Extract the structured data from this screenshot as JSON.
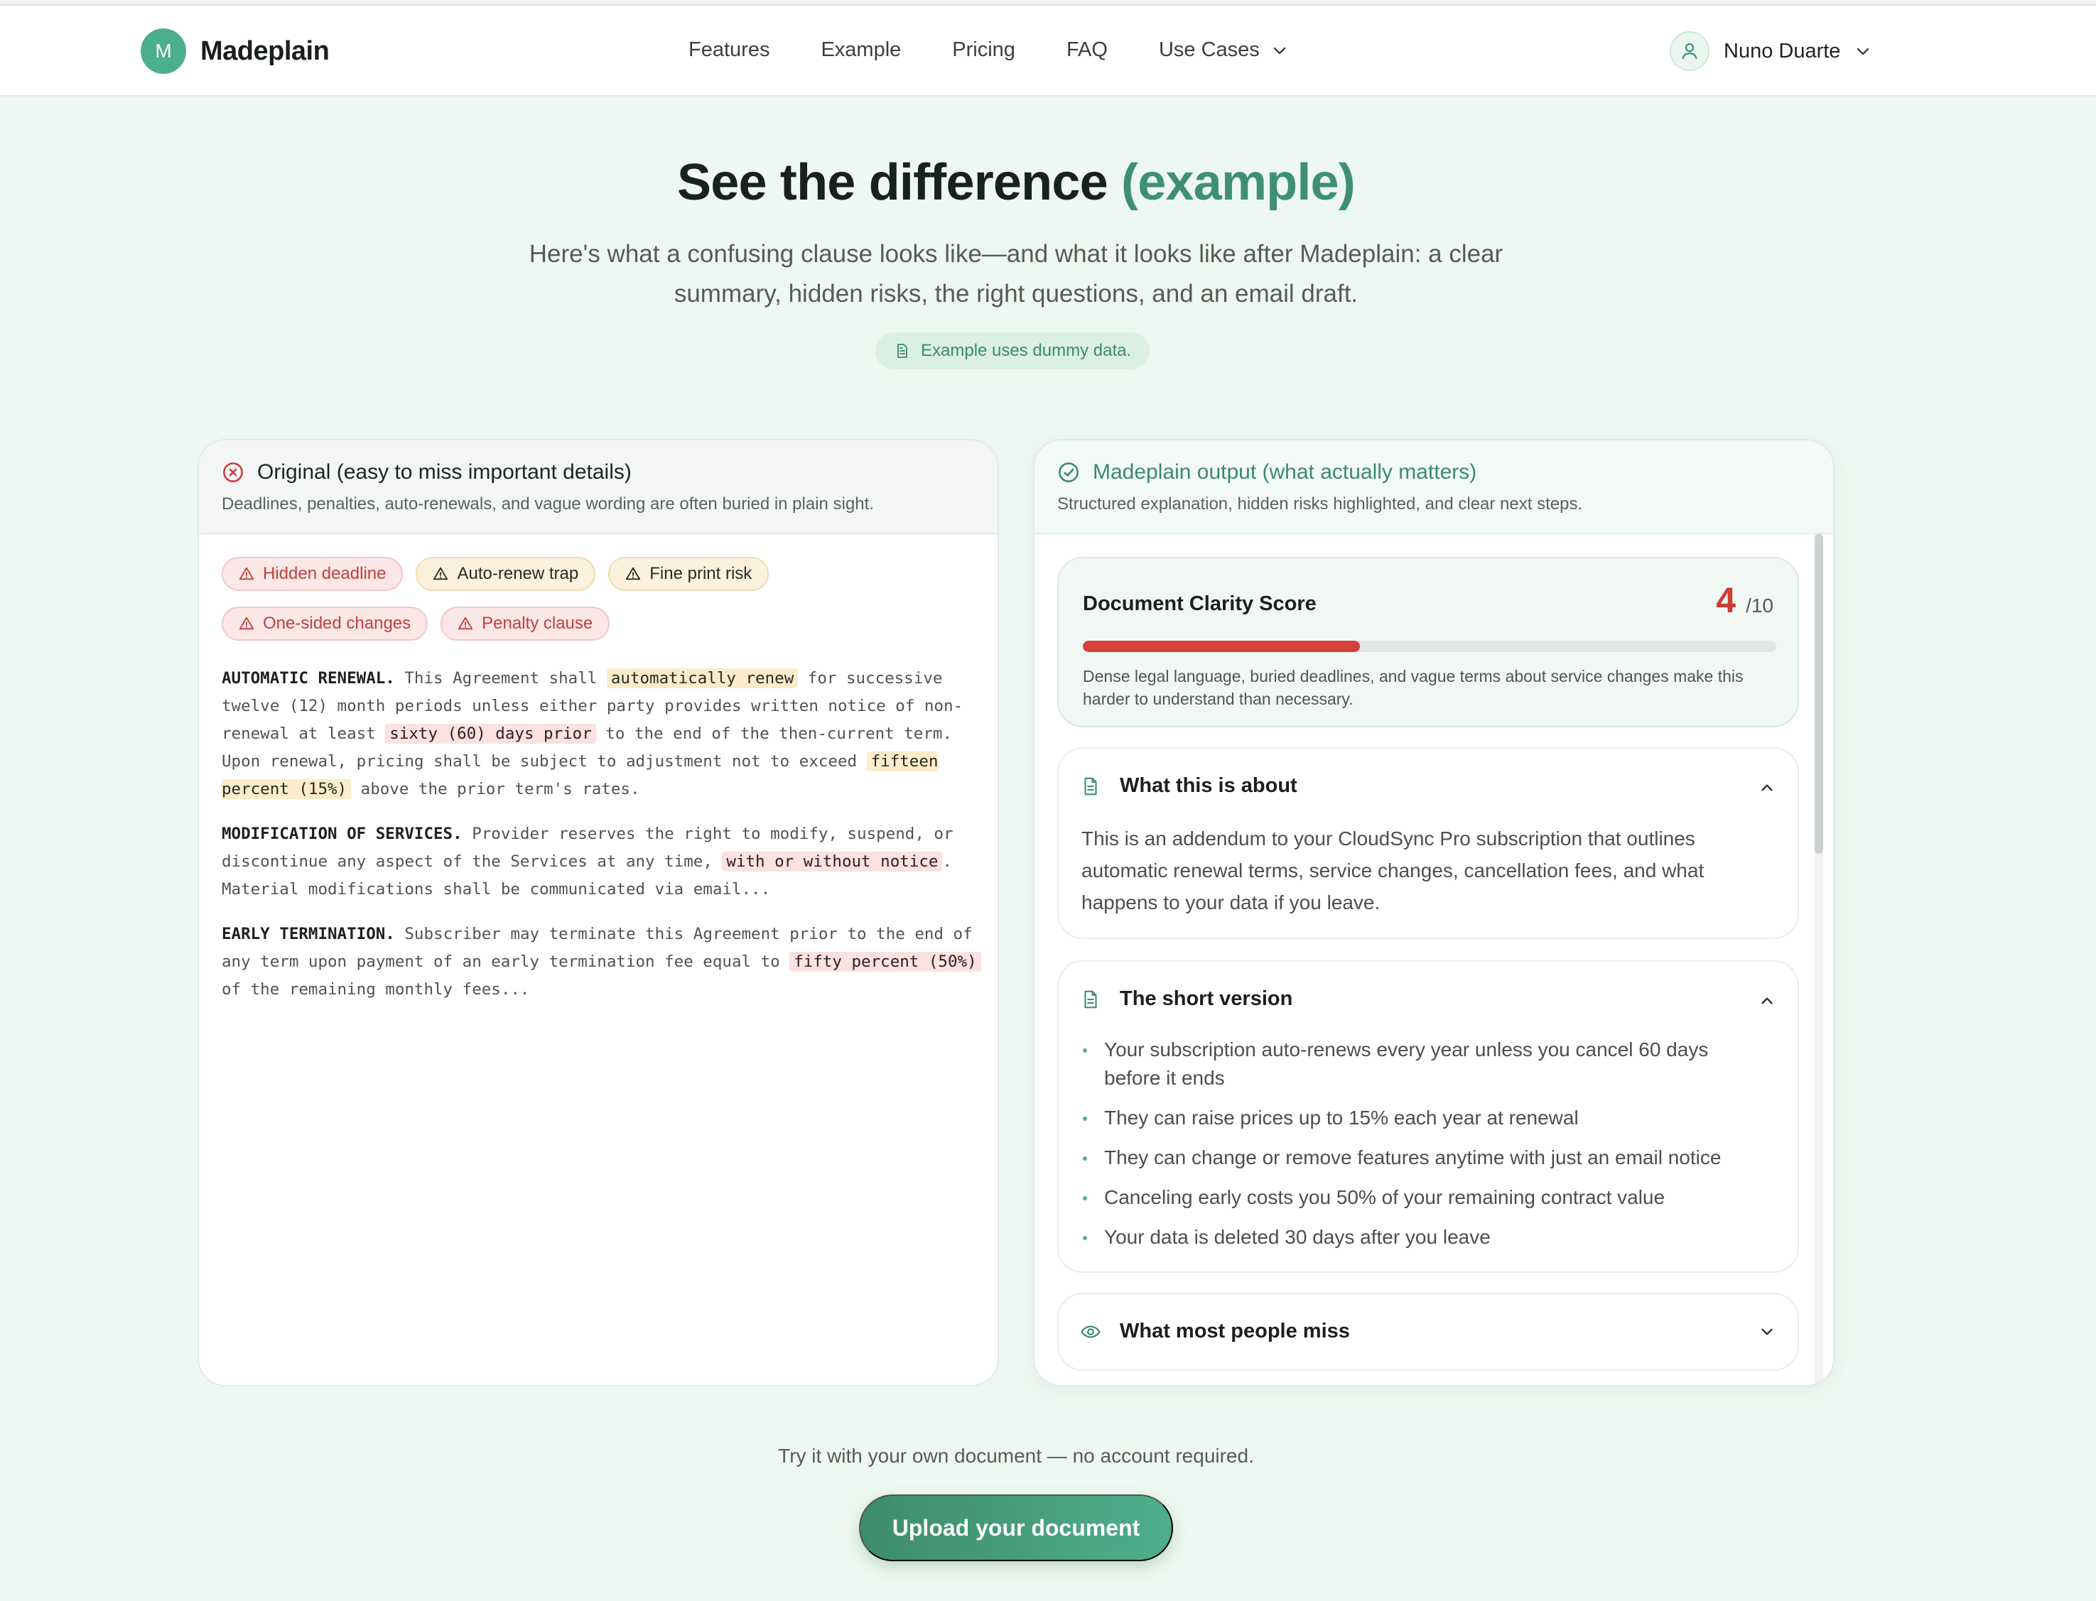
{
  "brand": {
    "initial": "M",
    "name": "Madeplain"
  },
  "nav": {
    "links": [
      "Features",
      "Example",
      "Pricing",
      "FAQ"
    ],
    "use_cases": "Use Cases"
  },
  "user": {
    "name": "Nuno Duarte"
  },
  "hero": {
    "title_main": "See the difference",
    "title_accent": "(example)",
    "subtitle": "Here's what a confusing clause looks like—and what it looks like after Madeplain: a clear summary, hidden risks, the right questions, and an email draft.",
    "dummy_note": "Example uses dummy data."
  },
  "original": {
    "title": "Original (easy to miss important details)",
    "desc": "Deadlines, penalties, auto-renewals, and vague wording are often buried in plain sight.",
    "tags_row1": [
      {
        "label": "Hidden deadline",
        "tone": "red"
      },
      {
        "label": "Auto-renew trap",
        "tone": "amber"
      },
      {
        "label": "Fine print risk",
        "tone": "amber"
      }
    ],
    "tags_row2": [
      {
        "label": "One-sided changes",
        "tone": "red"
      },
      {
        "label": "Penalty clause",
        "tone": "red"
      }
    ],
    "clauses": {
      "c1_head": "AUTOMATIC RENEWAL.",
      "c1_a": " This Agreement shall ",
      "c1_hl1": "automatically renew",
      "c1_b": " for successive twelve (12) month periods unless either party provides written notice of non-renewal at least ",
      "c1_hl2": "sixty (60) days prior",
      "c1_c": " to the end of the then-current term. Upon renewal, pricing shall be subject to adjustment not to exceed ",
      "c1_hl3": "fifteen percent (15%)",
      "c1_d": " above the prior term's rates.",
      "c2_head": "MODIFICATION OF SERVICES.",
      "c2_a": " Provider reserves the right to modify, suspend, or discontinue any aspect of the Services at any time, ",
      "c2_hl1": "with or without notice",
      "c2_b": ". Material modifications shall be communicated via email...",
      "c3_head": "EARLY TERMINATION.",
      "c3_a": " Subscriber may terminate this Agreement prior to the end of any term upon payment of an early termination fee equal to ",
      "c3_hl1": "fifty percent (50%)",
      "c3_b": " of the remaining monthly fees..."
    }
  },
  "output": {
    "title": "Madeplain output (what actually matters)",
    "desc": "Structured explanation, hidden risks highlighted, and clear next steps.",
    "score": {
      "label": "Document Clarity Score",
      "value": "4",
      "max": "/10",
      "fraction": 0.4,
      "desc": "Dense legal language, buried deadlines, and vague terms about service changes make this harder to understand than necessary."
    },
    "about": {
      "title": "What this is about",
      "body": "This is an addendum to your CloudSync Pro subscription that outlines automatic renewal terms, service changes, cancellation fees, and what happens to your data if you leave."
    },
    "short": {
      "title": "The short version",
      "items": [
        "Your subscription auto-renews every year unless you cancel 60 days before it ends",
        "They can raise prices up to 15% each year at renewal",
        "They can change or remove features anytime with just an email notice",
        "Canceling early costs you 50% of your remaining contract value",
        "Your data is deleted 30 days after you leave"
      ]
    },
    "miss": {
      "title": "What most people miss"
    }
  },
  "cta": {
    "try_text": "Try it with your own document — no account required.",
    "upload_label": "Upload your document"
  },
  "colors": {
    "accent": "#3f8f74",
    "danger": "#cf3b35",
    "background": "#eef8f2"
  }
}
